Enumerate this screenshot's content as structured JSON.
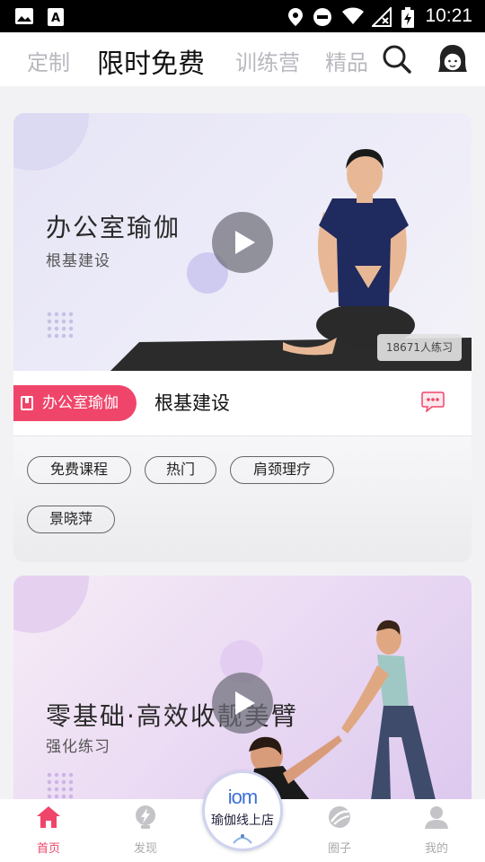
{
  "status_bar": {
    "time": "10:21"
  },
  "top_tabs": [
    {
      "label": "定制"
    },
    {
      "label": "限时免费",
      "active": true
    },
    {
      "label": "训练营"
    },
    {
      "label": "精品"
    }
  ],
  "icons": {
    "search": "search-icon",
    "avatar": "avatar-icon"
  },
  "cards": [
    {
      "hero_title": "办公室瑜伽",
      "hero_subtitle": "根基建设",
      "practice_count": "18671人练习",
      "category": "办公室瑜伽",
      "title": "根基建设",
      "tags": [
        "免费课程",
        "热门",
        "肩颈理疗",
        "景晓萍"
      ]
    },
    {
      "hero_title": "零基础·高效收靓美臂",
      "hero_subtitle": "强化练习"
    }
  ],
  "bottom_nav": {
    "items": [
      {
        "label": "首页",
        "icon": "home-icon",
        "active": true
      },
      {
        "label": "发现",
        "icon": "discover-icon"
      },
      {
        "label": "圈子",
        "icon": "circle-icon"
      },
      {
        "label": "我的",
        "icon": "profile-icon"
      }
    ],
    "center": {
      "logo": "iom",
      "label": "瑜伽线上店"
    }
  },
  "colors": {
    "accent": "#f0456a",
    "tab_inactive": "#b8b8bf",
    "brand_blue": "#3d6fd8"
  }
}
